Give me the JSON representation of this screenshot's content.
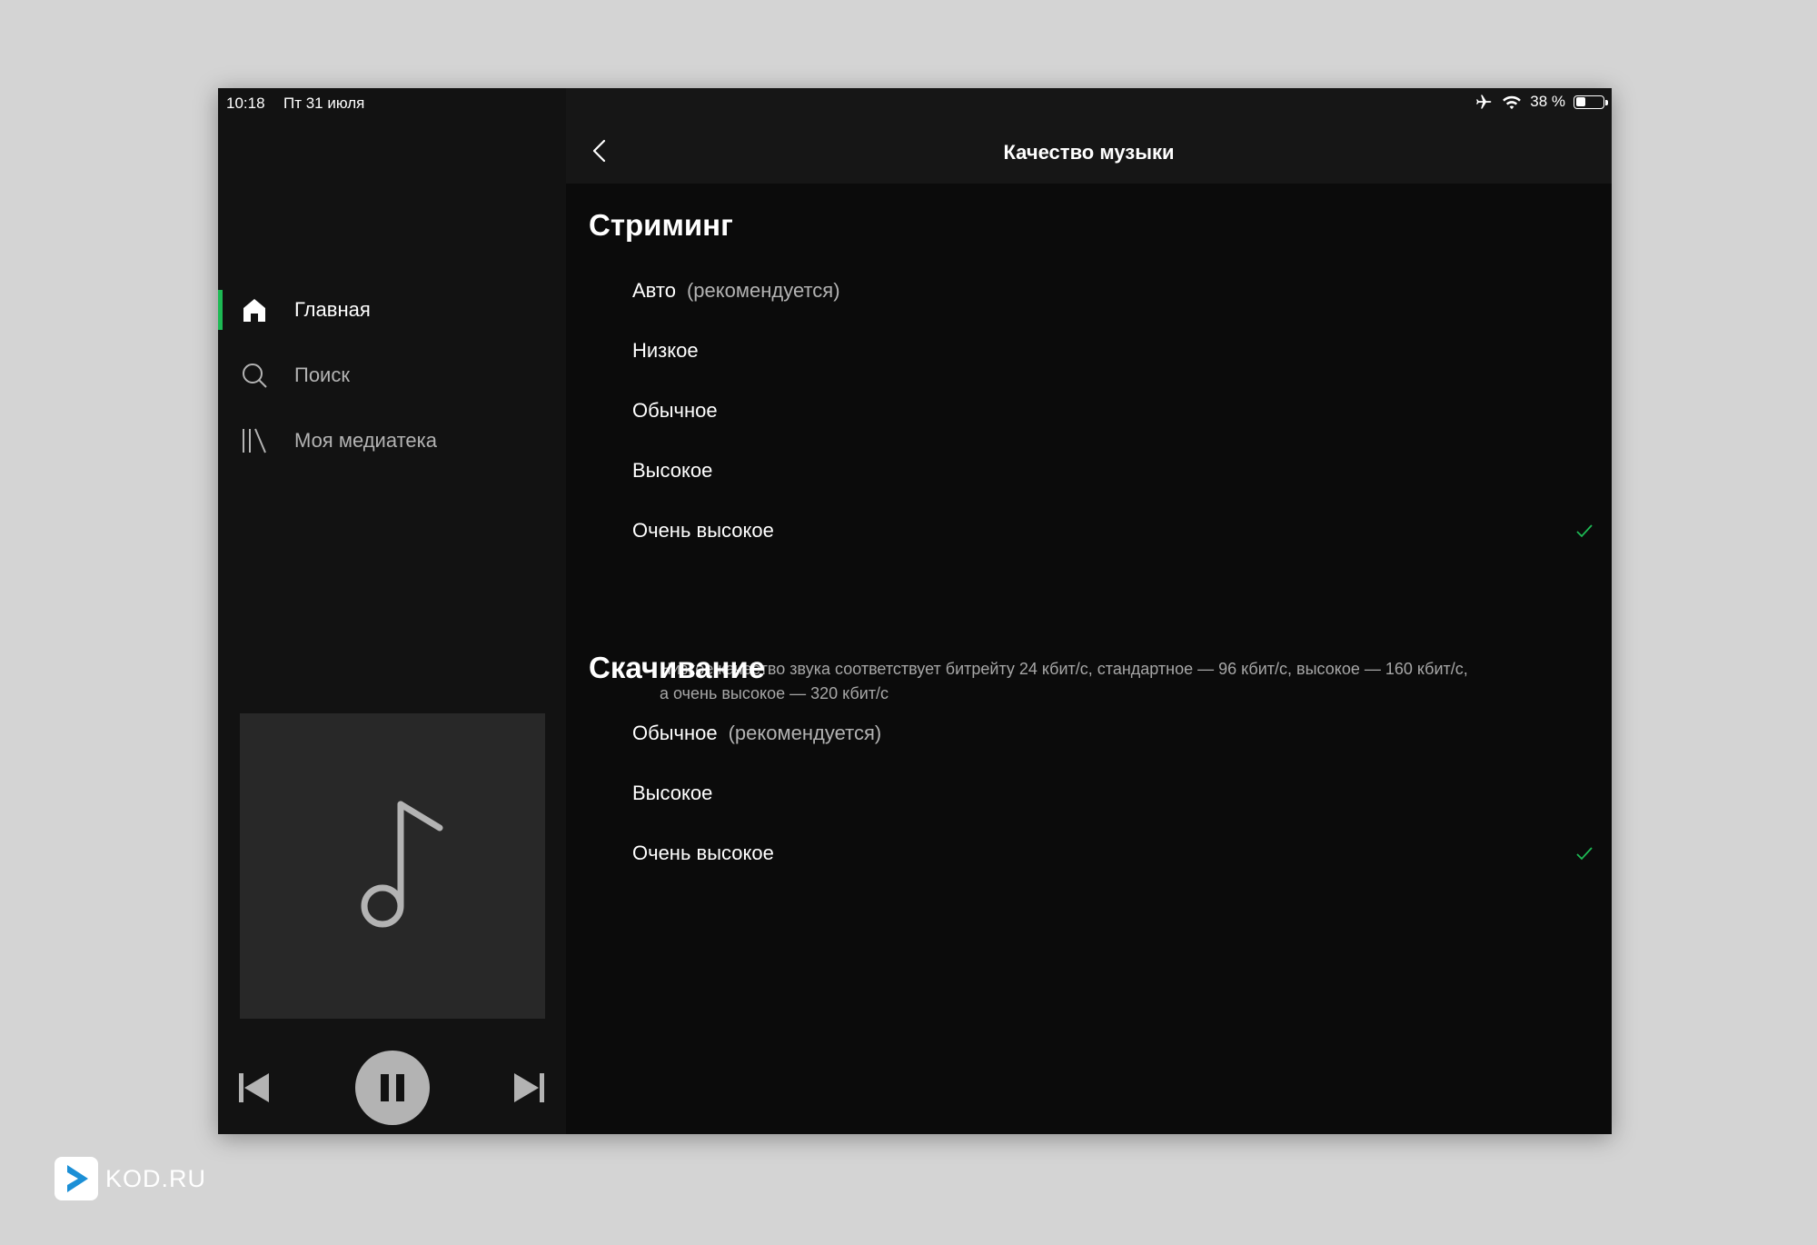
{
  "status_bar": {
    "time": "10:18",
    "date": "Пт 31 июля",
    "battery": "38 %",
    "battery_level": 0.38
  },
  "sidebar": {
    "items": [
      {
        "label": "Главная",
        "icon": "home-icon",
        "active": true
      },
      {
        "label": "Поиск",
        "icon": "search-icon",
        "active": false
      },
      {
        "label": "Моя медиатека",
        "icon": "library-icon",
        "active": false
      }
    ]
  },
  "player": {
    "art_icon": "music-note-icon",
    "controls": [
      "previous-track-icon",
      "pause-icon",
      "next-track-icon"
    ]
  },
  "header": {
    "title": "Качество музыки"
  },
  "streaming": {
    "title": "Стриминг",
    "options": [
      {
        "label": "Авто",
        "hint": "(рекомендуется)",
        "selected": false
      },
      {
        "label": "Низкое",
        "hint": "",
        "selected": false
      },
      {
        "label": "Обычное",
        "hint": "",
        "selected": false
      },
      {
        "label": "Высокое",
        "hint": "",
        "selected": false
      },
      {
        "label": "Очень высокое",
        "hint": "",
        "selected": true
      }
    ],
    "note": "Низкое качество звука соответствует битрейту 24 кбит/с, стандартное — 96 кбит/с, высокое — 160 кбит/с, а очень высокое — 320 кбит/с"
  },
  "download": {
    "title": "Скачивание",
    "options": [
      {
        "label": "Обычное",
        "hint": "(рекомендуется)",
        "selected": false
      },
      {
        "label": "Высокое",
        "hint": "",
        "selected": false
      },
      {
        "label": "Очень высокое",
        "hint": "",
        "selected": true
      }
    ]
  },
  "colors": {
    "accent": "#1db954",
    "sidebar_bg": "#121212",
    "main_bg": "#0b0b0b",
    "header_bg": "#161616",
    "art_bg": "#282828"
  },
  "watermark": {
    "text": "KOD.RU"
  }
}
